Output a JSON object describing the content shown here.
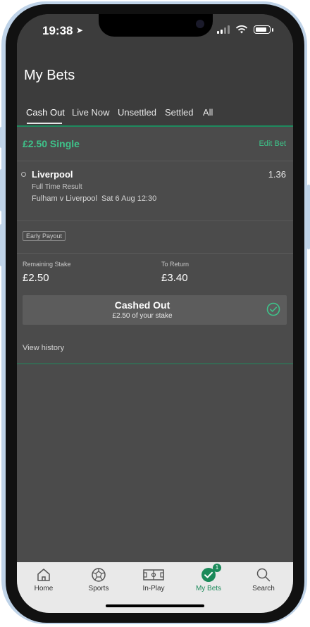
{
  "status_bar": {
    "time": "19:38"
  },
  "header": {
    "title": "My Bets"
  },
  "tabs": [
    {
      "label": "Cash Out"
    },
    {
      "label": "Live Now"
    },
    {
      "label": "Unsettled"
    },
    {
      "label": "Settled"
    },
    {
      "label": "All"
    }
  ],
  "bet": {
    "title": "£2.50 Single",
    "edit_label": "Edit Bet",
    "selection": "Liverpool",
    "odds": "1.36",
    "market": "Full Time Result",
    "event": "Fulham v Liverpool",
    "event_date": "Sat 6 Aug 12:30",
    "early_payout": "Early Payout",
    "remaining_stake_label": "Remaining Stake",
    "remaining_stake_value": "£2.50",
    "to_return_label": "To Return",
    "to_return_value": "£3.40",
    "cashout_title": "Cashed Out",
    "cashout_sub": "£2.50 of your stake",
    "view_history": "View history"
  },
  "bottom_nav": {
    "items": [
      {
        "label": "Home",
        "icon": "home-icon"
      },
      {
        "label": "Sports",
        "icon": "football-icon"
      },
      {
        "label": "In-Play",
        "icon": "pitch-icon"
      },
      {
        "label": "My Bets",
        "icon": "check-circle-icon",
        "badge": "1"
      },
      {
        "label": "Search",
        "icon": "search-icon"
      }
    ]
  },
  "colors": {
    "accent": "#3ec38a",
    "nav_active": "#1b8a5a",
    "background": "#4b4b4b"
  }
}
